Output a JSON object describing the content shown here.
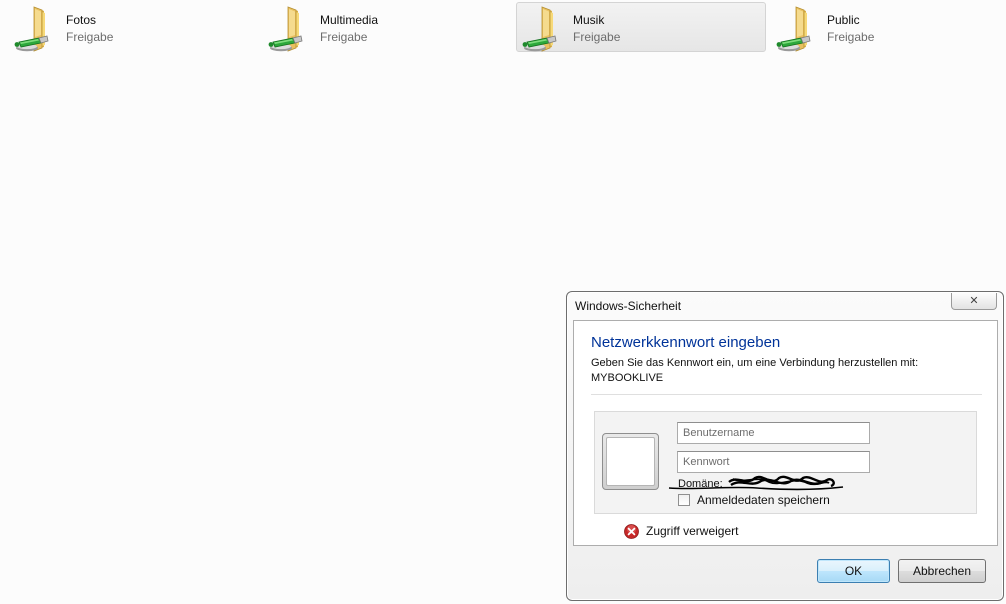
{
  "shares": [
    {
      "name": "Fotos",
      "subtitle": "Freigabe"
    },
    {
      "name": "Multimedia",
      "subtitle": "Freigabe"
    },
    {
      "name": "Musik",
      "subtitle": "Freigabe"
    },
    {
      "name": "Public",
      "subtitle": "Freigabe"
    }
  ],
  "dialog": {
    "title": "Windows-Sicherheit",
    "close_symbol": "✕",
    "heading": "Netzwerkkennwort eingeben",
    "description": "Geben Sie das Kennwort ein, um eine Verbindung herzustellen mit:",
    "server": "MYBOOKLIVE",
    "username_placeholder": "Benutzername",
    "password_placeholder": "Kennwort",
    "domain_label": "Domäne:",
    "remember_label": "Anmeldedaten speichern",
    "error_text": "Zugriff verweigert",
    "ok_label": "OK",
    "cancel_label": "Abbrechen"
  },
  "colors": {
    "heading": "#003399",
    "error_red": "#c62828",
    "ok_border": "#3c7fb1"
  }
}
